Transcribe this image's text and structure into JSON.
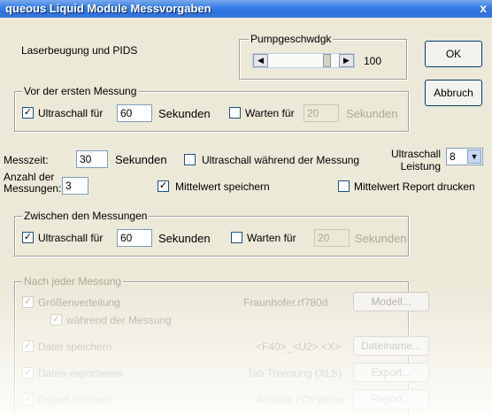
{
  "window": {
    "title": "queous Liquid Module Messvorgaben",
    "close": "x"
  },
  "top": {
    "method_label": "Laserbeugung und PIDS",
    "pump": {
      "label": "Pumpgeschwdgk",
      "value": "100",
      "level": 0.88
    },
    "ok": "OK",
    "cancel": "Abbruch"
  },
  "before": {
    "legend": "Vor der ersten Messung",
    "ultra_label": "Ultraschall für",
    "ultra_value": "60",
    "ultra_unit": "Sekunden",
    "ultra_checked": "✓",
    "wait_label": "Warten für",
    "wait_value": "20",
    "wait_unit": "Sekunden"
  },
  "measure": {
    "time_label": "Messzeit:",
    "time_value": "30",
    "time_unit": "Sekunden",
    "ultra_during_label": "Ultraschall während der Messung",
    "power_label_1": "Ultraschall",
    "power_label_2": "Leistung",
    "power_value": "8",
    "count_label_1": "Anzahl der",
    "count_label_2": "Messungen:",
    "count_value": "3",
    "mean_save_label": "Mittelwert speichern",
    "mean_save_checked": "✓",
    "mean_report_label": "Mittelwert Report drucken"
  },
  "between": {
    "legend": "Zwischen den Messungen",
    "ultra_label": "Ultraschall für",
    "ultra_value": "60",
    "ultra_unit": "Sekunden",
    "ultra_checked": "✓",
    "wait_label": "Warten für",
    "wait_value": "20",
    "wait_unit": "Sekunden"
  },
  "after": {
    "legend": "Nach jeder Messung",
    "size_label": "Größenverteilung",
    "size_model": "Fraunhofer.rf780d",
    "size_button": "Modell...",
    "checked": "✓",
    "during_label": "während der Messung",
    "save_label": "Datei speichern",
    "save_pattern": "<F40>_<U2>.<X>",
    "save_button": "Dateiname...",
    "export_label": "Daten exportieren",
    "export_format": "Tab Trennung (XLS)",
    "export_button": "Export...",
    "print_label": "Report drucken",
    "print_device": "Acrobat PDFWriter",
    "print_button": "Report..."
  }
}
